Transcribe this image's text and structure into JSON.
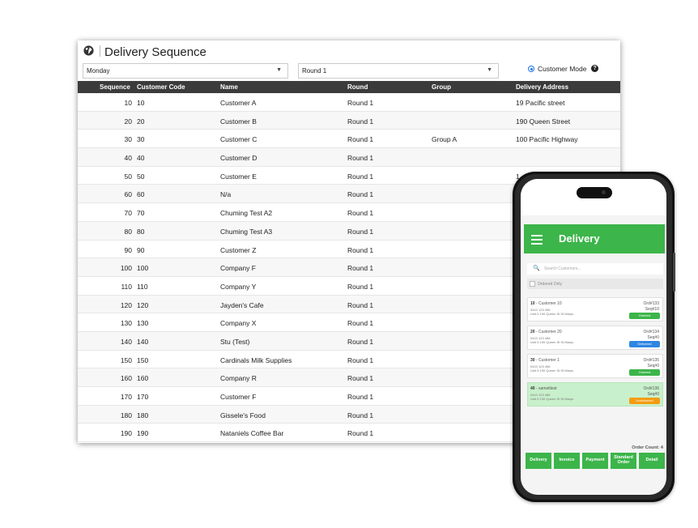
{
  "window": {
    "title": "Delivery Sequence",
    "day_select": "Monday",
    "round_select": "Round 1",
    "customer_mode_label": "Customer Mode"
  },
  "table": {
    "headers": [
      "Sequence",
      "Customer Code",
      "Name",
      "Round",
      "Group",
      "Delivery Address"
    ],
    "rows": [
      {
        "seq": "10",
        "code": "10",
        "name": "Customer A",
        "round": "Round 1",
        "group": "",
        "address": "19 Pacific street"
      },
      {
        "seq": "20",
        "code": "20",
        "name": "Customer B",
        "round": "Round 1",
        "group": "",
        "address": "190 Queen Street"
      },
      {
        "seq": "30",
        "code": "30",
        "name": "Customer C",
        "round": "Round 1",
        "group": "Group A",
        "address": "100 Pacific Highway"
      },
      {
        "seq": "40",
        "code": "40",
        "name": "Customer D",
        "round": "Round 1",
        "group": "",
        "address": ""
      },
      {
        "seq": "50",
        "code": "50",
        "name": "Customer E",
        "round": "Round 1",
        "group": "",
        "address": "1"
      },
      {
        "seq": "60",
        "code": "60",
        "name": "N/a",
        "round": "Round 1",
        "group": "",
        "address": ""
      },
      {
        "seq": "70",
        "code": "70",
        "name": "Chuming Test A2",
        "round": "Round 1",
        "group": "",
        "address": ""
      },
      {
        "seq": "80",
        "code": "80",
        "name": "Chuming Test A3",
        "round": "Round 1",
        "group": "",
        "address": ""
      },
      {
        "seq": "90",
        "code": "90",
        "name": "Customer Z",
        "round": "Round 1",
        "group": "",
        "address": ""
      },
      {
        "seq": "100",
        "code": "100",
        "name": "Company F",
        "round": "Round 1",
        "group": "",
        "address": ""
      },
      {
        "seq": "110",
        "code": "110",
        "name": "Company Y",
        "round": "Round 1",
        "group": "",
        "address": ""
      },
      {
        "seq": "120",
        "code": "120",
        "name": "Jayden's Cafe",
        "round": "Round 1",
        "group": "",
        "address": ""
      },
      {
        "seq": "130",
        "code": "130",
        "name": "Company X",
        "round": "Round 1",
        "group": "",
        "address": ""
      },
      {
        "seq": "140",
        "code": "140",
        "name": "Stu (Test)",
        "round": "Round 1",
        "group": "",
        "address": ""
      },
      {
        "seq": "150",
        "code": "150",
        "name": "Cardinals Milk Supplies",
        "round": "Round 1",
        "group": "",
        "address": ""
      },
      {
        "seq": "160",
        "code": "160",
        "name": "Company R",
        "round": "Round 1",
        "group": "",
        "address": ""
      },
      {
        "seq": "170",
        "code": "170",
        "name": "Customer F",
        "round": "Round 1",
        "group": "",
        "address": ""
      },
      {
        "seq": "180",
        "code": "180",
        "name": "Gissele's Food",
        "round": "Round 1",
        "group": "",
        "address": ""
      },
      {
        "seq": "190",
        "code": "190",
        "name": "Nataniels Coffee Bar",
        "round": "Round 1",
        "group": "",
        "address": ""
      }
    ]
  },
  "phone": {
    "app_title": "Delivery",
    "search_placeholder": "Search Customers...",
    "ordered_only": "Ordered Only",
    "cards": [
      {
        "num": "10",
        "name": "Customer 10",
        "order": "Ord#133",
        "phone": "0410 123 456",
        "address": "Unit 5 190 Queen St St Marys",
        "seq": "Seq#10",
        "status": "Ordered",
        "status_color": "#3cb54a",
        "highlight": false
      },
      {
        "num": "20",
        "name": "Customer 20",
        "order": "Ord#134",
        "phone": "0410 123 456",
        "address": "Unit 5 190 Queen St St Marys",
        "seq": "Seq#0",
        "status": "Delivered",
        "status_color": "#2f86e0",
        "highlight": false
      },
      {
        "num": "30",
        "name": "Customer 1",
        "order": "Ord#135",
        "phone": "0410 123 456",
        "address": "Unit 5 190 Queen St St Marys",
        "seq": "Seq#0",
        "status": "Ordered",
        "status_color": "#3cb54a",
        "highlight": false
      },
      {
        "num": "40",
        "name": "samelitest",
        "order": "Ord#136",
        "phone": "0410 123 456",
        "address": "Unit 5 190 Queen St St Marys",
        "seq": "Seq#0",
        "status": "Undelivered",
        "status_color": "#f39c12",
        "highlight": true
      }
    ],
    "order_count": "Order Count: 4",
    "buttons": [
      "Delivery",
      "Invoice",
      "Payment",
      "Standard Order",
      "Detail"
    ]
  }
}
